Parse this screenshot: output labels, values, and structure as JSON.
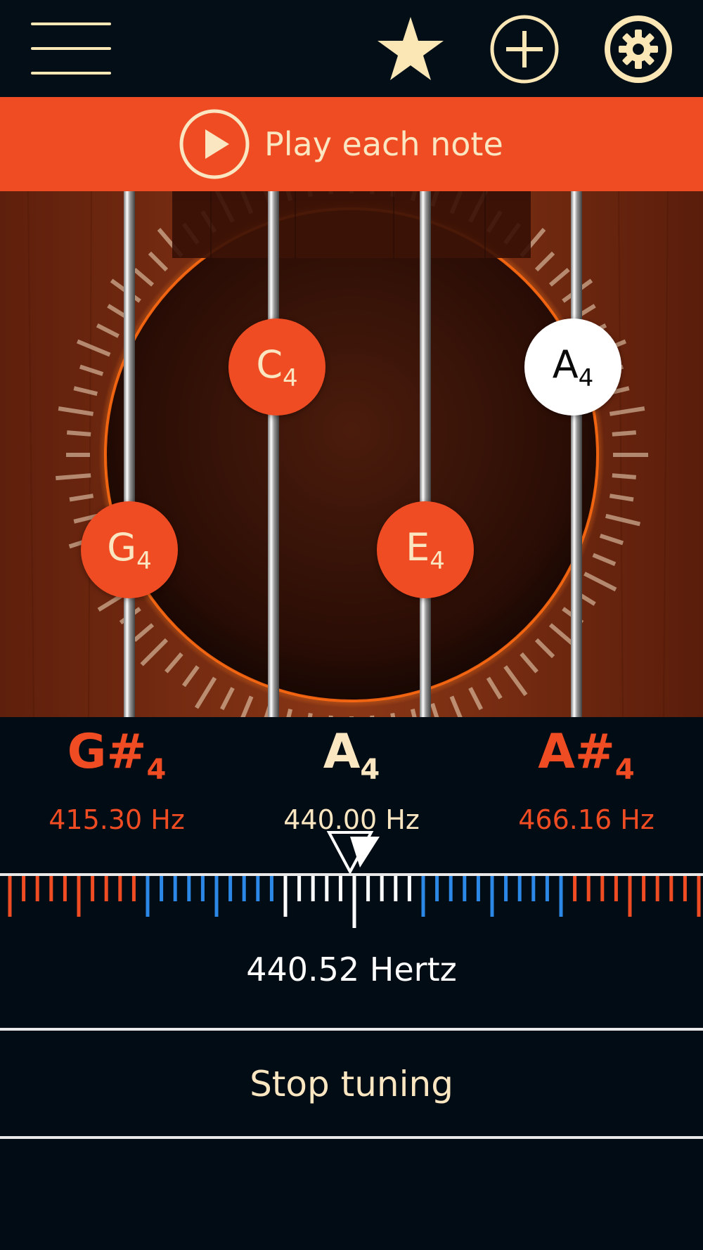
{
  "toolbar": {
    "menu_icon": "hamburger-menu-icon",
    "favorite_icon": "star-icon",
    "add_icon": "plus-circle-icon",
    "settings_icon": "gear-icon",
    "icon_color": "#fbe6b6"
  },
  "banner": {
    "label": "Play each note",
    "icon": "play-circle-icon",
    "color": "#ef4c23"
  },
  "strings": [
    {
      "note": "G",
      "octave": "4",
      "selected": false
    },
    {
      "note": "C",
      "octave": "4",
      "selected": false
    },
    {
      "note": "E",
      "octave": "4",
      "selected": false
    },
    {
      "note": "A",
      "octave": "4",
      "selected": true
    }
  ],
  "notes_display": {
    "previous": {
      "note": "G#",
      "octave": "4",
      "freq": "415.30 Hz"
    },
    "current": {
      "note": "A",
      "octave": "4",
      "freq": "440.00 Hz"
    },
    "next": {
      "note": "A#",
      "octave": "4",
      "freq": "466.16 Hz"
    }
  },
  "tuner": {
    "frequency_label": "440.52 Hertz",
    "needle_icon": "triangle-pointer-icon",
    "colors": {
      "out_of_tune": "#ef4c23",
      "near": "#2c88e6",
      "in_tune": "#ffffff"
    }
  },
  "actions": {
    "stop_label": "Stop tuning"
  }
}
